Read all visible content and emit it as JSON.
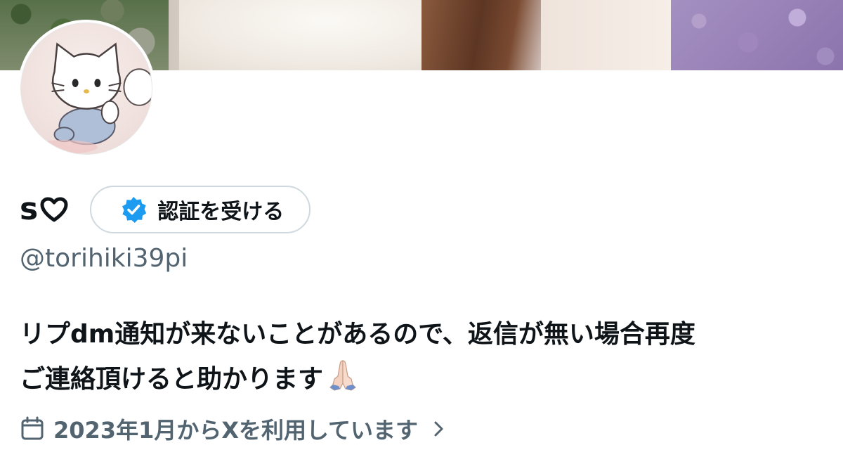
{
  "profile": {
    "display_name": "s",
    "name_heart_icon": "heart-outline-icon",
    "verify_button": {
      "label": "認証を受ける",
      "icon": "verified-badge-icon",
      "badge_color": "#1d9bf0"
    },
    "handle": "@torihiki39pi",
    "bio_line1": "リプdm通知が来ないことがあるので、返信が無い場合再度",
    "bio_line2": "ご連絡頂けると助かります",
    "bio_emoji": "folded-hands-emoji",
    "joined_text": "2023年1月からXを利用しています",
    "joined_icon": "calendar-icon",
    "joined_chevron": "chevron-right-icon"
  },
  "colors": {
    "text_primary": "#0f1419",
    "text_secondary": "#536471",
    "border": "#cfd9de",
    "accent": "#1d9bf0"
  }
}
